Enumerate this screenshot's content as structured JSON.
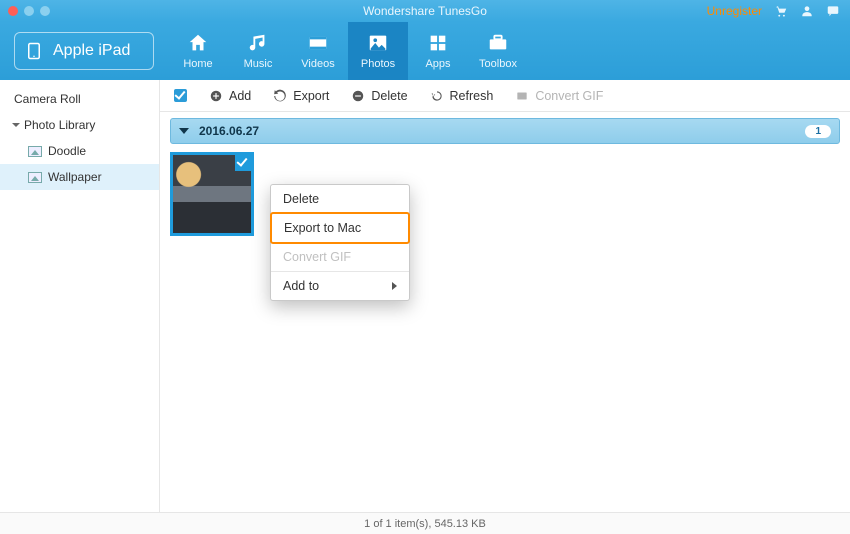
{
  "titlebar": {
    "title": "Wondershare TunesGo",
    "unregister": "Unregister"
  },
  "device": {
    "name": "Apple iPad"
  },
  "tabs": [
    {
      "id": "home",
      "label": "Home"
    },
    {
      "id": "music",
      "label": "Music"
    },
    {
      "id": "videos",
      "label": "Videos"
    },
    {
      "id": "photos",
      "label": "Photos",
      "active": true
    },
    {
      "id": "apps",
      "label": "Apps"
    },
    {
      "id": "toolbox",
      "label": "Toolbox"
    }
  ],
  "sidebar": {
    "items": [
      {
        "label": "Camera Roll",
        "type": "item"
      },
      {
        "label": "Photo Library",
        "type": "group",
        "expanded": true
      },
      {
        "label": "Doodle",
        "type": "subitem"
      },
      {
        "label": "Wallpaper",
        "type": "subitem",
        "selected": true
      }
    ]
  },
  "toolbar": {
    "add": "Add",
    "export": "Export",
    "delete": "Delete",
    "refresh": "Refresh",
    "convert_gif": "Convert GIF"
  },
  "group": {
    "date": "2016.06.27",
    "count": "1"
  },
  "context_menu": {
    "items": [
      {
        "label": "Delete"
      },
      {
        "label": "Export to Mac",
        "highlight": true
      },
      {
        "label": "Convert GIF",
        "disabled": true
      },
      {
        "label": "Add to",
        "submenu": true
      }
    ]
  },
  "status": {
    "text": "1 of 1 item(s), 545.13 KB"
  }
}
